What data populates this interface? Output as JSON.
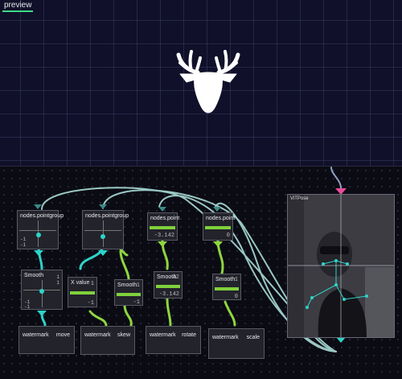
{
  "preview": {
    "tab_label": "preview",
    "logo_icon": "deer-head-icon"
  },
  "colors": {
    "wire_teal": "#2ed3c8",
    "wire_green": "#8ed63f",
    "wire_gray": "#9ac8c4",
    "accent_pink": "#ea4c9a",
    "slider_green": "#7fd13b"
  },
  "nodes": {
    "pointgroup1": {
      "title": "nodes.pointgroup",
      "v1": "-1",
      "v2": "1",
      "v3": "1",
      "v4": "-1"
    },
    "pointgroup2": {
      "title": "nodes.pointgroup"
    },
    "point1": {
      "title": "nodes.point",
      "value": "-3.142"
    },
    "point2": {
      "title": "nodes.point",
      "value": "0"
    },
    "smooth1": {
      "title": "Smooth",
      "v1": "1",
      "v2": "1",
      "v3": "-1",
      "v4": "-1"
    },
    "xvalue": {
      "title": "X value",
      "top": "1",
      "value": "-1"
    },
    "smooth2": {
      "title": "Smooth",
      "top": "1",
      "value": "-1"
    },
    "smooth3": {
      "title": "Smooth",
      "top": "42",
      "value": "-3.142"
    },
    "smooth4": {
      "title": "Smooth",
      "top": "1",
      "value": "0"
    },
    "watermarks": [
      {
        "label": "watermark",
        "action": "move"
      },
      {
        "label": "watermark",
        "action": "skew"
      },
      {
        "label": "watermark",
        "action": "rotate"
      },
      {
        "label": "watermark",
        "action": "scale"
      }
    ],
    "vitpose": {
      "title": "ViTPose"
    }
  }
}
